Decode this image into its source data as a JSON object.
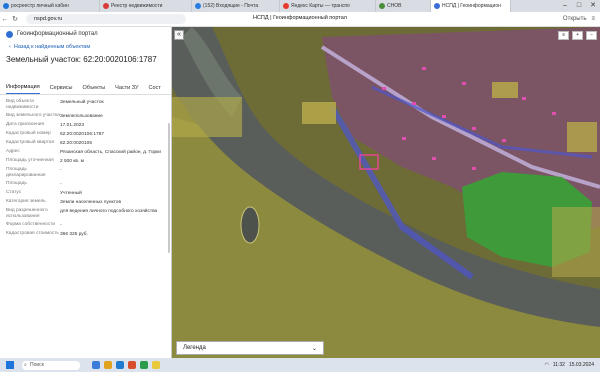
{
  "browser": {
    "tabs": [
      {
        "label": "росреестр личный кабин",
        "color": "#1e74d9"
      },
      {
        "label": "Реестр недвижимости",
        "color": "#d83a3a"
      },
      {
        "label": "(152) Входящие - Почта",
        "color": "#2a7de1"
      },
      {
        "label": "Яндекс Карты — транспо",
        "color": "#e53c2f"
      },
      {
        "label": "СНОВ",
        "color": "#4b8e3a"
      },
      {
        "label": "НСПД | Геоинформацион",
        "color": "#3a6dd8"
      }
    ],
    "url": "nspd.gov.ru",
    "page_title": "НСПД | Геоинформационный портал",
    "translate_label": "Открыть"
  },
  "panel": {
    "brand": "Геоинформационный портал",
    "back_link": "Назад к найденным объектам",
    "title": "Земельный участок: 62:20:0020106:1787",
    "tabs": [
      "Информация",
      "Сервисы",
      "Объекты",
      "Части ЗУ",
      "Сост"
    ],
    "rows": [
      {
        "k": "Вид объекта недвижимости",
        "v": "Земельный участок"
      },
      {
        "k": "Вид земельного участка",
        "v": "Землепользование"
      },
      {
        "k": "Дата присвоения",
        "v": "17.01.2023"
      },
      {
        "k": "Кадастровый номер",
        "v": "62:20:0020106:1787"
      },
      {
        "k": "Кадастровый квартал",
        "v": "62:20:0020106"
      },
      {
        "k": "Адрес",
        "v": "Рязанская область, Спасский район, д. Горки"
      },
      {
        "k": "Площадь уточненная",
        "v": "2 500 кв. м"
      },
      {
        "k": "Площадь декларированная",
        "v": "-"
      },
      {
        "k": "Площадь",
        "v": "-"
      },
      {
        "k": "Статус",
        "v": "Учтенный"
      },
      {
        "k": "Категория земель",
        "v": "Земли населенных пунктов"
      },
      {
        "k": "Вид разрешенного использования",
        "v": "для ведения личного подсобного хозяйства"
      },
      {
        "k": "Форма собственности",
        "v": "-"
      },
      {
        "k": "Кадастровая стоимость",
        "v": "366 325 руб."
      }
    ]
  },
  "map": {
    "collapse_icon": "«",
    "legend_label": "Легенда",
    "colors": {
      "water": "#5b5f5c",
      "farmland": "#9a8f3e",
      "village": "#7a5160",
      "forest": "#3fa33a",
      "zone": "#4e56c9"
    }
  },
  "taskbar": {
    "search_placeholder": "Поиск",
    "time": "11:32",
    "date": "15.03.2024"
  }
}
